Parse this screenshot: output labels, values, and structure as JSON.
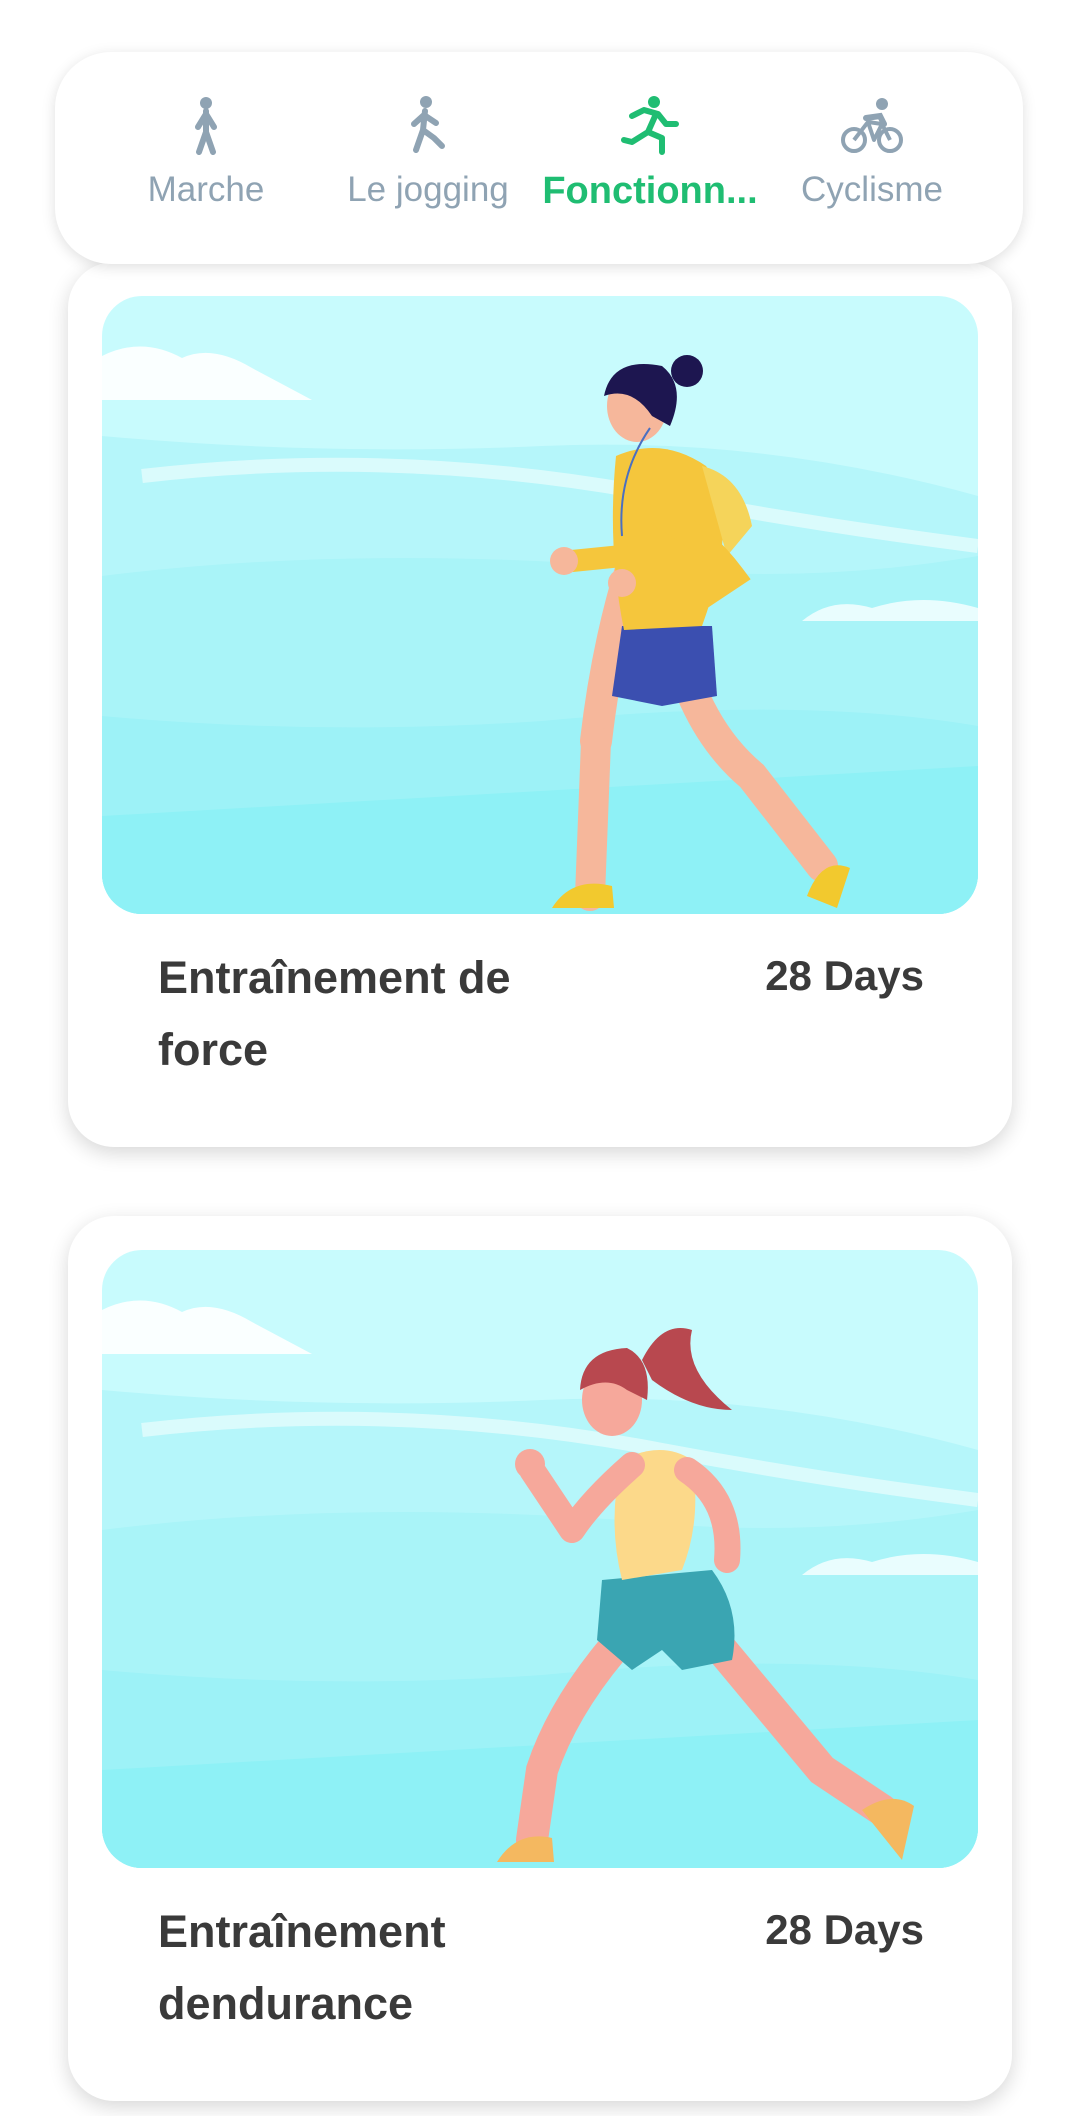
{
  "tabs": [
    {
      "label": "Marche",
      "icon": "walking-icon",
      "active": false
    },
    {
      "label": "Le jogging",
      "icon": "jogging-icon",
      "active": false
    },
    {
      "label": "Fonctionn...",
      "icon": "running-icon",
      "active": true
    },
    {
      "label": "Cyclisme",
      "icon": "cycling-icon",
      "active": false
    }
  ],
  "colors": {
    "active": "#1fbd72",
    "inactive": "#8fa3b3",
    "text": "#3a3a3a",
    "sky": "#c8fbfd",
    "ground": "#8ef1f6"
  },
  "plans": [
    {
      "title": "Entraînement de force",
      "duration": "28 Days",
      "image": "woman-jogging-yellow-hoodie"
    },
    {
      "title": "Entraînement dendurance",
      "duration": "28 Days",
      "image": "woman-running-ponytail"
    }
  ]
}
